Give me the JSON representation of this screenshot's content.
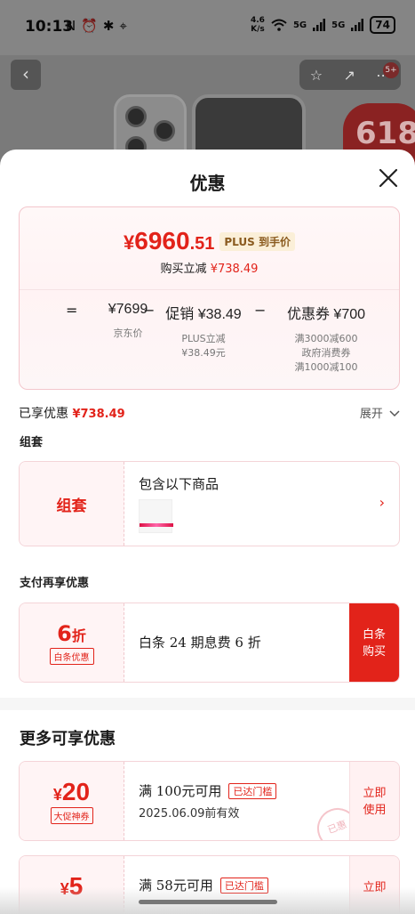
{
  "status_bar": {
    "time": "10:13",
    "left_icons": [
      "N",
      "⏰",
      "✱",
      "⌖"
    ],
    "speed_value": "4.6",
    "speed_unit": "K/s",
    "sig1": "5G",
    "sig2": "5G",
    "battery": "74"
  },
  "product_bg": {
    "badge": "5+",
    "promo": "618"
  },
  "sheet": {
    "title": "优惠"
  },
  "price_card": {
    "yen": "¥",
    "price_int": "6960",
    "price_dec": ".51",
    "plus_tag": "PLUS 到手价",
    "instant_label": "购买立减",
    "instant_value": "¥738.49",
    "eq": "=",
    "minus1": "−",
    "minus2": "−",
    "jd_price_value": "¥7699",
    "jd_price_label": "京东价",
    "promo_value": "促销 ¥38.49",
    "promo_label_1": "PLUS立减",
    "promo_label_2": "¥38.49元",
    "coupon_value": "优惠券 ¥700",
    "coupon_label_1": "满3000减600",
    "coupon_label_2": "政府消费券",
    "coupon_label_3": "满1000减100"
  },
  "enjoyed": {
    "label": "已享优惠",
    "value": "¥738.49",
    "expand_label": "展开"
  },
  "bundle": {
    "section": "组套",
    "left_label": "组套",
    "text": "包含以下商品",
    "arrow": "›"
  },
  "pay": {
    "section": "支付再享优惠",
    "discount": "6",
    "discount_unit": "折",
    "tag": "白条优惠",
    "text": "白条 24 期息费 6 折",
    "btn_1": "白条",
    "btn_2": "购买"
  },
  "more": {
    "title": "更多可享优惠",
    "coupons": [
      {
        "yen": "¥",
        "amount": "20",
        "tag": "大促神券",
        "cond": "满 100元可用",
        "reached": "已达门槛",
        "date": "2025.06.09前有效",
        "btn_1": "立即",
        "btn_2": "使用",
        "stamp": "已惠"
      },
      {
        "yen": "¥",
        "amount": "5",
        "tag": "",
        "cond": "满 58元可用",
        "reached": "已达门槛",
        "date": "",
        "btn_1": "立即",
        "btn_2": ""
      }
    ]
  }
}
